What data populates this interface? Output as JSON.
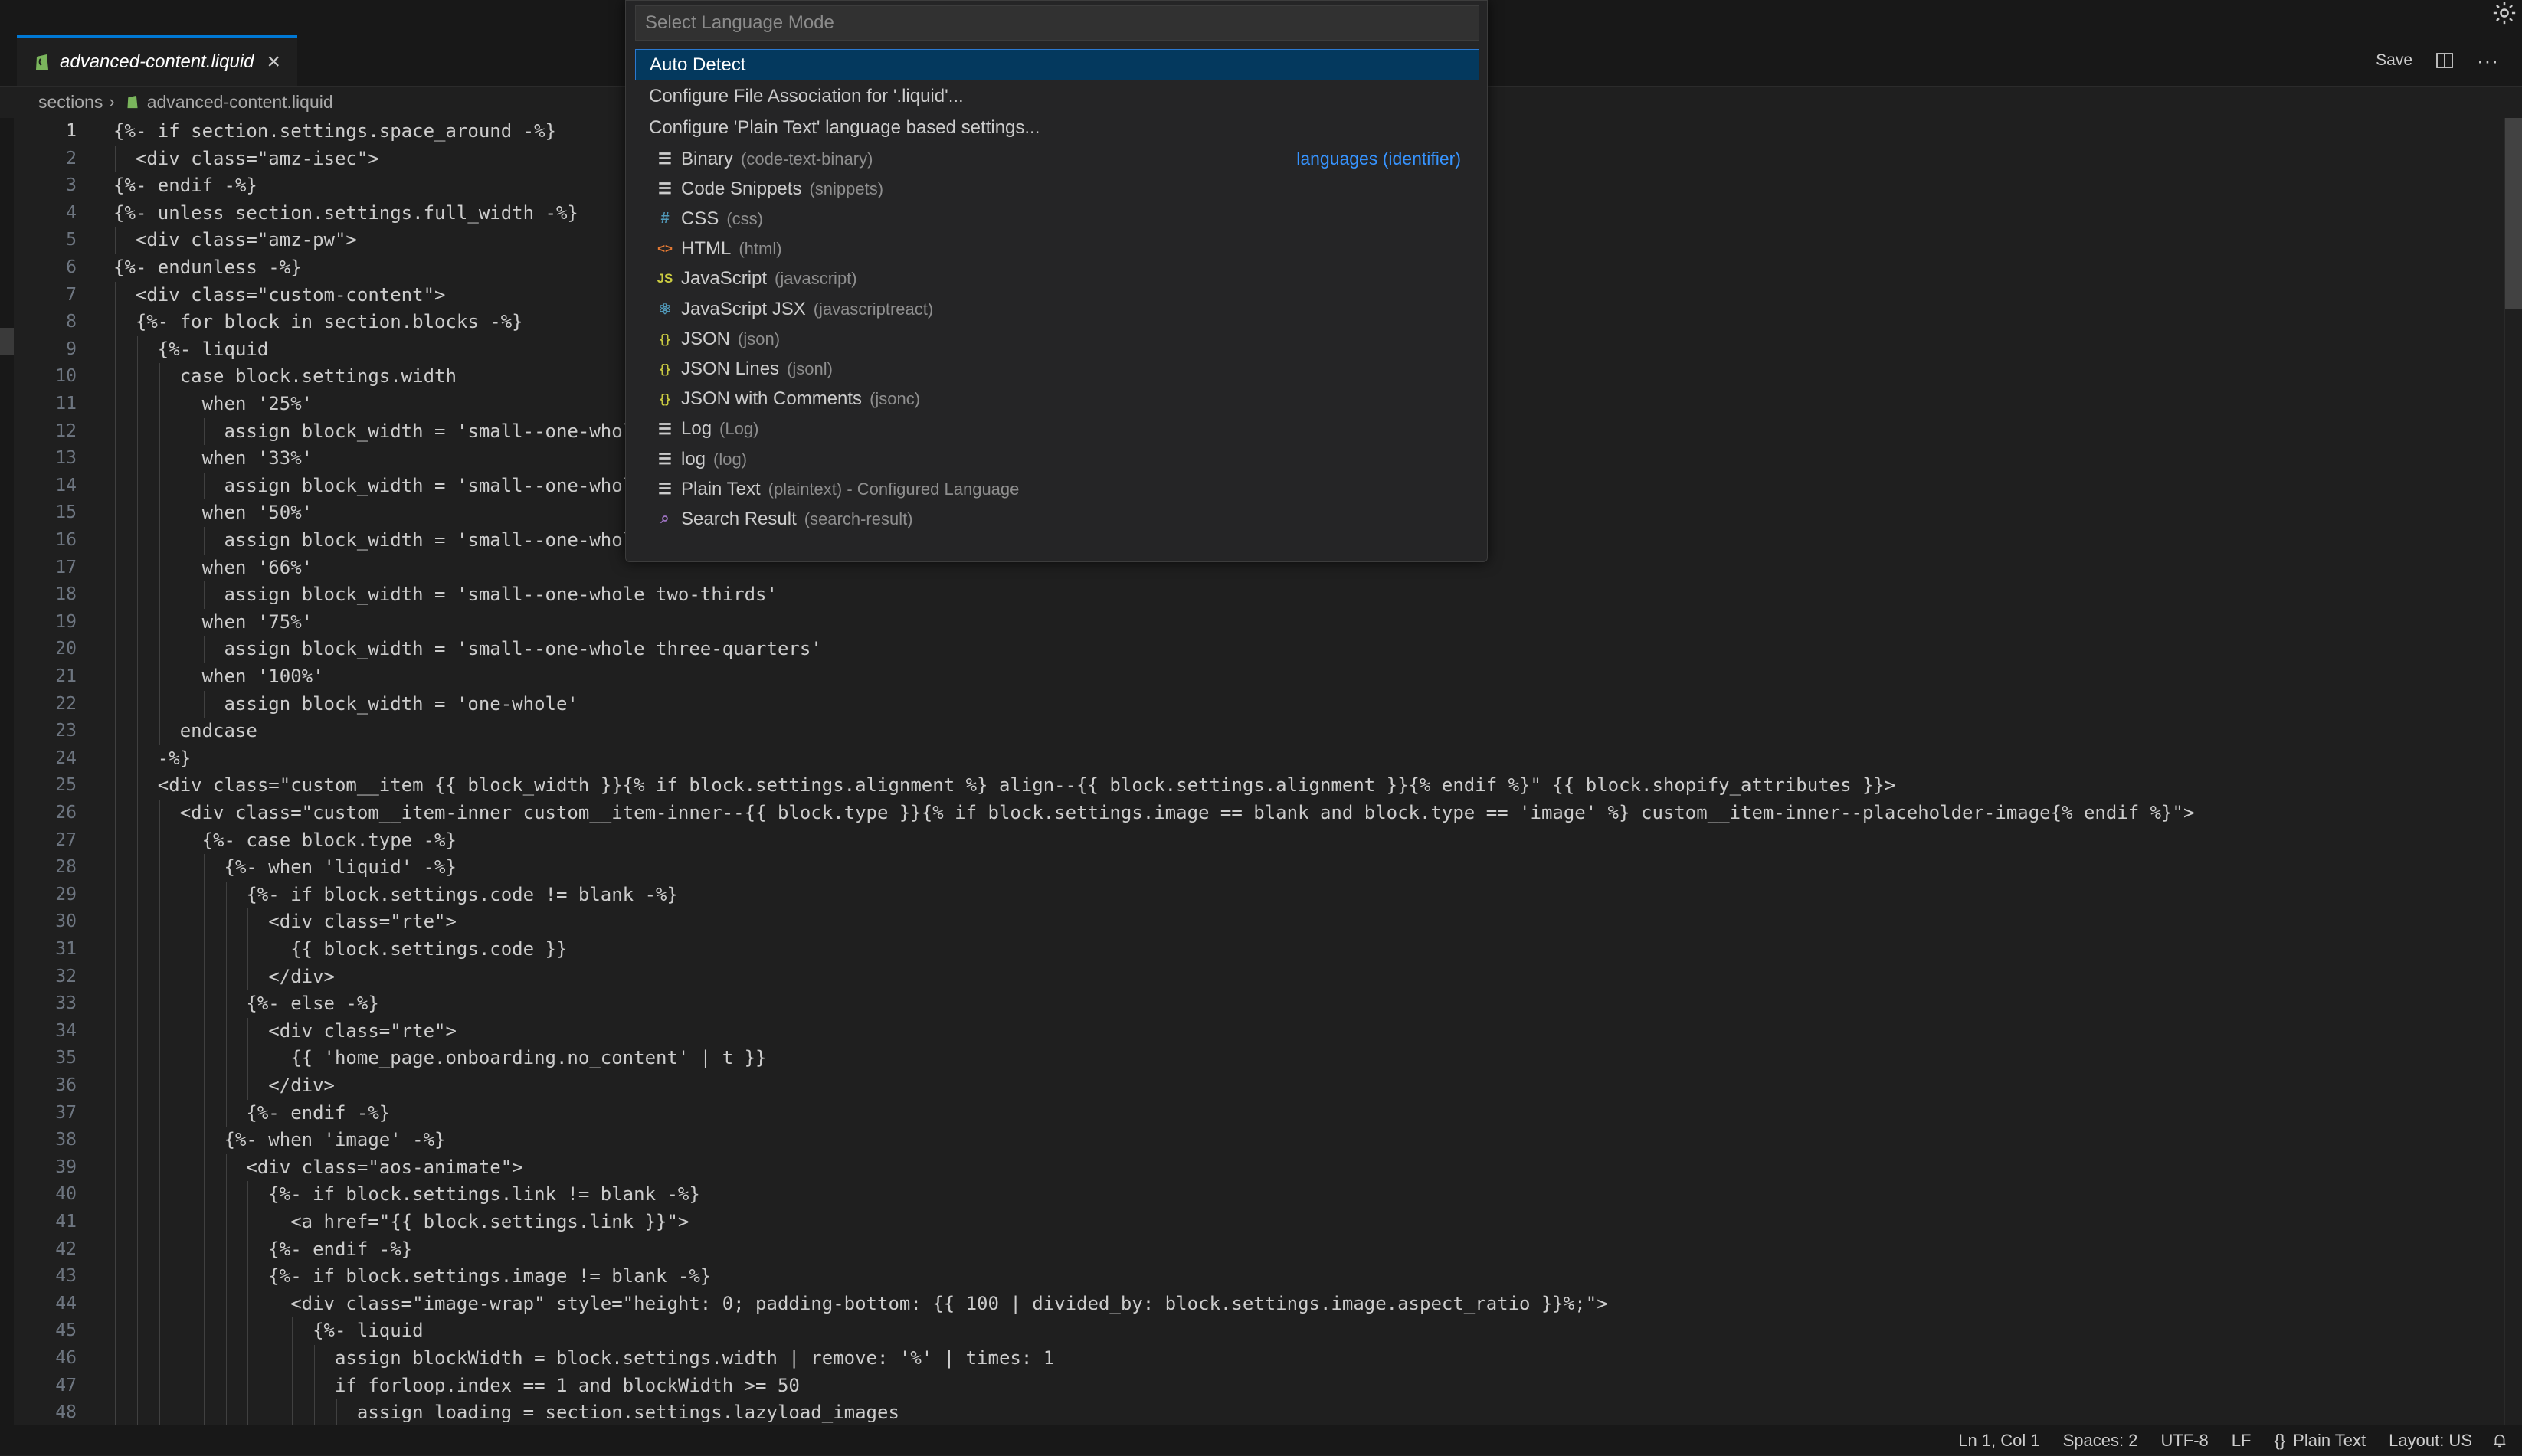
{
  "tab": {
    "title": "advanced-content.liquid"
  },
  "toolbar": {
    "save_label": "Save"
  },
  "breadcrumb": {
    "folder": "sections",
    "file": "advanced-content.liquid"
  },
  "quickpick": {
    "placeholder": "Select Language Mode",
    "commands": [
      "Auto Detect",
      "Configure File Association for '.liquid'...",
      "Configure 'Plain Text' language based settings..."
    ],
    "group_label": "languages (identifier)",
    "languages": [
      {
        "icon": "lines-icon",
        "name": "Binary",
        "desc": "(code-text-binary)"
      },
      {
        "icon": "lines-icon",
        "name": "Code Snippets",
        "desc": "(snippets)"
      },
      {
        "icon": "hash-icon",
        "name": "CSS",
        "desc": "(css)"
      },
      {
        "icon": "html-icon",
        "name": "HTML",
        "desc": "(html)"
      },
      {
        "icon": "js-icon",
        "name": "JavaScript",
        "desc": "(javascript)"
      },
      {
        "icon": "react-icon",
        "name": "JavaScript JSX",
        "desc": "(javascriptreact)"
      },
      {
        "icon": "braces-icon",
        "name": "JSON",
        "desc": "(json)"
      },
      {
        "icon": "braces-icon",
        "name": "JSON Lines",
        "desc": "(jsonl)"
      },
      {
        "icon": "braces-icon",
        "name": "JSON with Comments",
        "desc": "(jsonc)"
      },
      {
        "icon": "lines-icon",
        "name": "Log",
        "desc": "(Log)"
      },
      {
        "icon": "lines-icon",
        "name": "log",
        "desc": "(log)"
      },
      {
        "icon": "lines-icon",
        "name": "Plain Text",
        "desc": "(plaintext) - Configured Language"
      },
      {
        "icon": "search-icon",
        "name": "Search Result",
        "desc": "(search-result)"
      }
    ]
  },
  "code_lines": [
    "{%- if section.settings.space_around -%}",
    "  <div class=\"amz-isec\">",
    "{%- endif -%}",
    "{%- unless section.settings.full_width -%}",
    "  <div class=\"amz-pw\">",
    "{%- endunless -%}",
    "  <div class=\"custom-content\">",
    "  {%- for block in section.blocks -%}",
    "    {%- liquid",
    "      case block.settings.width",
    "        when '25%'",
    "          assign block_width = 'small--one-whol",
    "        when '33%'",
    "          assign block_width = 'small--one-whol",
    "        when '50%'",
    "          assign block_width = 'small--one-whol",
    "        when '66%'",
    "          assign block_width = 'small--one-whole two-thirds'",
    "        when '75%'",
    "          assign block_width = 'small--one-whole three-quarters'",
    "        when '100%'",
    "          assign block_width = 'one-whole'",
    "      endcase",
    "    -%}",
    "    <div class=\"custom__item {{ block_width }}{% if block.settings.alignment %} align--{{ block.settings.alignment }}{% endif %}\" {{ block.shopify_attributes }}>",
    "      <div class=\"custom__item-inner custom__item-inner--{{ block.type }}{% if block.settings.image == blank and block.type == 'image' %} custom__item-inner--placeholder-image{% endif %}\">",
    "        {%- case block.type -%}",
    "          {%- when 'liquid' -%}",
    "            {%- if block.settings.code != blank -%}",
    "              <div class=\"rte\">",
    "                {{ block.settings.code }}",
    "              </div>",
    "            {%- else -%}",
    "              <div class=\"rte\">",
    "                {{ 'home_page.onboarding.no_content' | t }}",
    "              </div>",
    "            {%- endif -%}",
    "          {%- when 'image' -%}",
    "            <div class=\"aos-animate\">",
    "              {%- if block.settings.link != blank -%}",
    "                <a href=\"{{ block.settings.link }}\">",
    "              {%- endif -%}",
    "              {%- if block.settings.image != blank -%}",
    "                <div class=\"image-wrap\" style=\"height: 0; padding-bottom: {{ 100 | divided_by: block.settings.image.aspect_ratio }}%;\">",
    "                  {%- liquid",
    "                    assign blockWidth = block.settings.width | remove: '%' | times: 1",
    "                    if forloop.index == 1 and blockWidth >= 50",
    "                      assign loading = section.settings.lazyload_images"
  ],
  "status": {
    "position": "Ln 1, Col 1",
    "spaces": "Spaces: 2",
    "encoding": "UTF-8",
    "eol": "LF",
    "language": "Plain Text",
    "layout": "Layout: US"
  },
  "colors": {
    "editor_bg": "#1f1f1f",
    "chrome_bg": "#181818",
    "accent": "#0078d4",
    "selection": "#04395e",
    "link": "#3794ff"
  }
}
